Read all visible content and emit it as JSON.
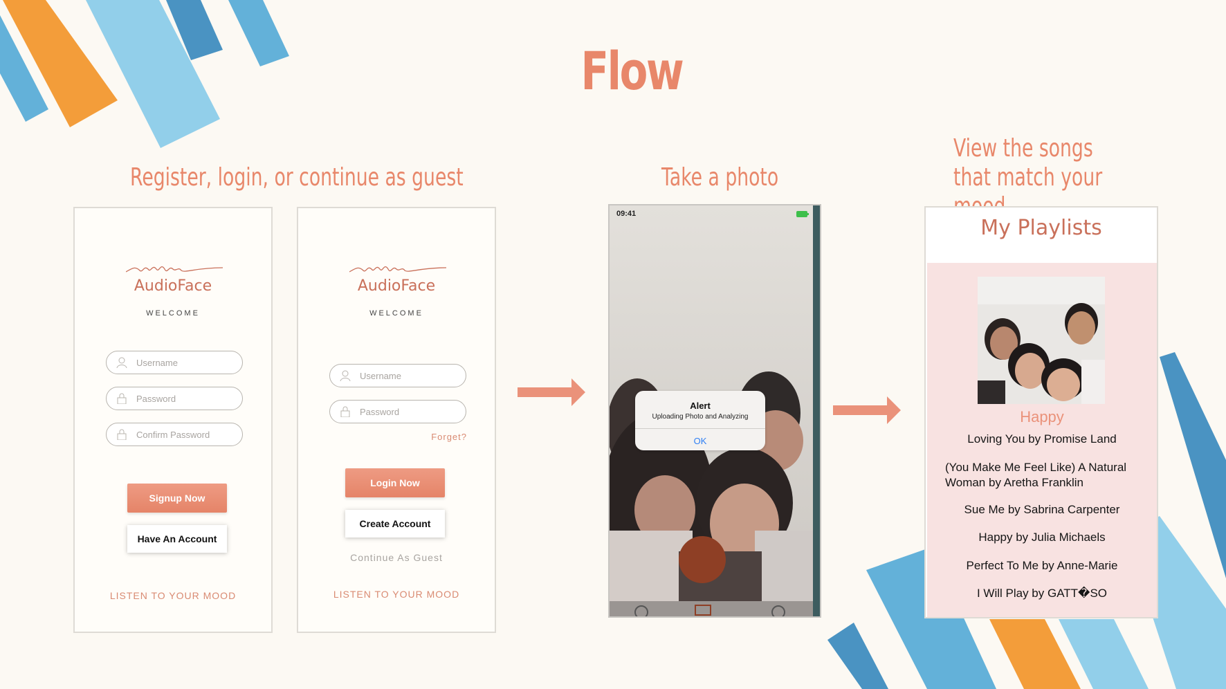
{
  "slide": {
    "title": "Flow",
    "captions": {
      "login": "Register, login, or continue as guest",
      "photo": "Take a photo",
      "songs": "View the songs that match your mood"
    }
  },
  "signup_screen": {
    "brand": "AudioFace",
    "tagline": "WELCOME",
    "fields": [
      "Username",
      "Password",
      "Confirm Password"
    ],
    "primary_button": "Signup Now",
    "secondary_button": "Have An Account",
    "footer": "LISTEN TO YOUR MOOD"
  },
  "login_screen": {
    "brand": "AudioFace",
    "tagline": "WELCOME",
    "fields": [
      "Username",
      "Password"
    ],
    "forgot_link": "Forget?",
    "primary_button": "Login Now",
    "secondary_button": "Create Account",
    "guest_link": "Continue As Guest",
    "footer": "LISTEN TO YOUR MOOD"
  },
  "camera_screen": {
    "status_time": "09:41",
    "alert": {
      "title": "Alert",
      "message": "Uploading Photo and Analyzing",
      "button": "OK"
    }
  },
  "playlist_screen": {
    "title": "My Playlists",
    "mood": "Happy",
    "songs": [
      "Loving You by Promise Land",
      "(You Make Me Feel Like) A Natural Woman by Aretha Franklin",
      "Sue Me by Sabrina Carpenter",
      "Happy by Julia Michaels",
      "Perfect To Me by Anne-Marie",
      "I Will Play by GATT�SO"
    ]
  },
  "colors": {
    "accent": "#e8876a",
    "background": "#fcf9f3",
    "blue_light": "#92cfea",
    "blue_mid": "#63b1d9",
    "blue_dark": "#4a93c2",
    "orange": "#f39d3a"
  }
}
